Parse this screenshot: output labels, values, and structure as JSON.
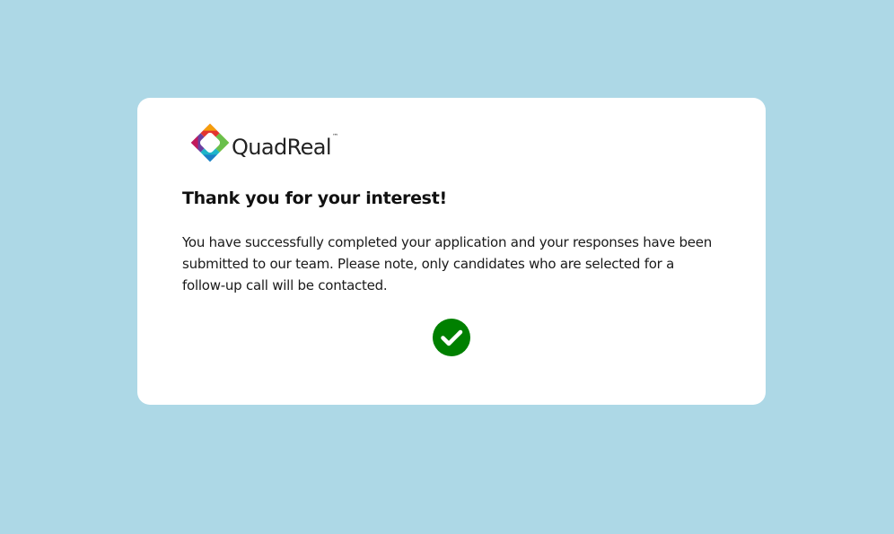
{
  "brand": {
    "name": "QuadReal",
    "trademark": "™",
    "logo_icon": "quadreal-logo-mark-icon",
    "colors": {
      "red": "#e3342f",
      "orange": "#f59e0b",
      "yellow": "#f2d024",
      "green": "#6abf4b",
      "teal": "#1fb5c9",
      "blue": "#1d7fc6",
      "purple": "#6b3fa0",
      "magenta": "#c2185b"
    }
  },
  "confirmation": {
    "heading": "Thank you for your interest!",
    "message": "You have successfully completed your application and your responses have been submitted to our team. Please note, only candidates who are selected for a follow-up call will be contacted.",
    "status_icon": "check-circle-icon",
    "status_color": "#008000"
  },
  "page": {
    "background": "#add8e6",
    "card_background": "#ffffff"
  }
}
